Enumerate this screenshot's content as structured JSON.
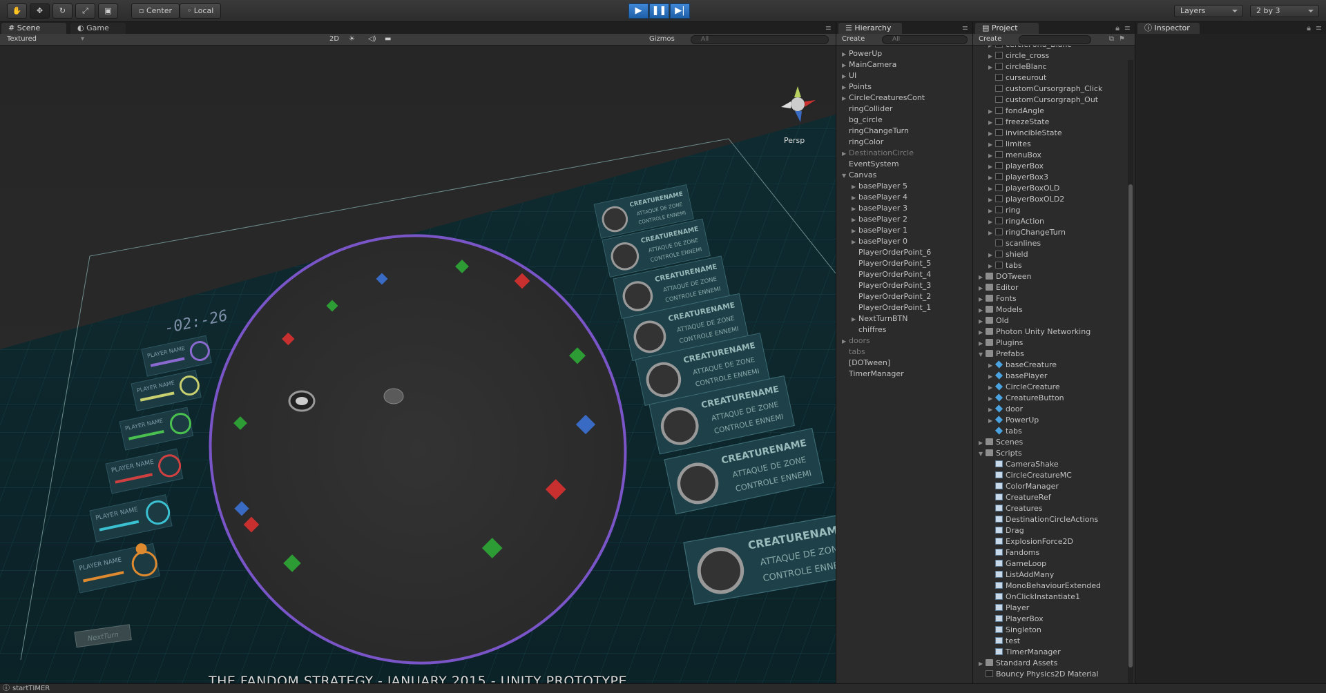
{
  "toolbar": {
    "center_label": "Center",
    "local_label": "Local",
    "layers_label": "Layers",
    "layout_label": "2 by 3"
  },
  "scene_panel": {
    "tabs": [
      {
        "label": "Scene"
      },
      {
        "label": "Game"
      }
    ],
    "render_mode": "Textured",
    "mode_2d": "2D",
    "gizmos": "Gizmos",
    "search_placeholder": "All",
    "persp": "Persp",
    "timer": "-02:-26",
    "player_name": "PLAYER NAME",
    "next_turn": "NextTurn",
    "creature_name": "CREATURENAME",
    "attack_zone": "ATTAQUE DE ZONE",
    "control_enemy": "CONTROLE ENNEMI"
  },
  "hierarchy": {
    "title": "Hierarchy",
    "create": "Create",
    "search": "All",
    "items": [
      {
        "label": "PowerUp",
        "indent": 0,
        "arrow": true,
        "dim": false
      },
      {
        "label": "MainCamera",
        "indent": 0,
        "arrow": true,
        "dim": false
      },
      {
        "label": "UI",
        "indent": 0,
        "arrow": true,
        "dim": false
      },
      {
        "label": "Points",
        "indent": 0,
        "arrow": true,
        "dim": false
      },
      {
        "label": "CircleCreaturesCont",
        "indent": 0,
        "arrow": true,
        "dim": false
      },
      {
        "label": "ringCollider",
        "indent": 0,
        "arrow": false,
        "dim": false
      },
      {
        "label": "bg_circle",
        "indent": 0,
        "arrow": false,
        "dim": false
      },
      {
        "label": "ringChangeTurn",
        "indent": 0,
        "arrow": false,
        "dim": false
      },
      {
        "label": "ringColor",
        "indent": 0,
        "arrow": false,
        "dim": false
      },
      {
        "label": "DestinationCircle",
        "indent": 0,
        "arrow": true,
        "dim": true
      },
      {
        "label": "EventSystem",
        "indent": 0,
        "arrow": false,
        "dim": false
      },
      {
        "label": "Canvas",
        "indent": 0,
        "arrow": true,
        "open": true,
        "dim": false
      },
      {
        "label": "basePlayer 5",
        "indent": 1,
        "arrow": true,
        "dim": false
      },
      {
        "label": "basePlayer 4",
        "indent": 1,
        "arrow": true,
        "dim": false
      },
      {
        "label": "basePlayer 3",
        "indent": 1,
        "arrow": true,
        "dim": false
      },
      {
        "label": "basePlayer 2",
        "indent": 1,
        "arrow": true,
        "dim": false
      },
      {
        "label": "basePlayer 1",
        "indent": 1,
        "arrow": true,
        "dim": false
      },
      {
        "label": "basePlayer 0",
        "indent": 1,
        "arrow": true,
        "dim": false
      },
      {
        "label": "PlayerOrderPoint_6",
        "indent": 1,
        "arrow": false,
        "dim": false
      },
      {
        "label": "PlayerOrderPoint_5",
        "indent": 1,
        "arrow": false,
        "dim": false
      },
      {
        "label": "PlayerOrderPoint_4",
        "indent": 1,
        "arrow": false,
        "dim": false
      },
      {
        "label": "PlayerOrderPoint_3",
        "indent": 1,
        "arrow": false,
        "dim": false
      },
      {
        "label": "PlayerOrderPoint_2",
        "indent": 1,
        "arrow": false,
        "dim": false
      },
      {
        "label": "PlayerOrderPoint_1",
        "indent": 1,
        "arrow": false,
        "dim": false
      },
      {
        "label": "NextTurnBTN",
        "indent": 1,
        "arrow": true,
        "dim": false
      },
      {
        "label": "chiffres",
        "indent": 1,
        "arrow": false,
        "dim": false
      },
      {
        "label": "doors",
        "indent": 0,
        "arrow": true,
        "dim": true
      },
      {
        "label": "tabs",
        "indent": 0,
        "arrow": false,
        "dim": true
      },
      {
        "label": "[DOTween]",
        "indent": 0,
        "arrow": false,
        "dim": false
      },
      {
        "label": "TimerManager",
        "indent": 0,
        "arrow": false,
        "dim": false
      }
    ]
  },
  "project": {
    "title": "Project",
    "create": "Create",
    "items": [
      {
        "label": "cercleFond_Blanc",
        "indent": 1,
        "icon": "sprite",
        "arrow": true
      },
      {
        "label": "circle_cross",
        "indent": 1,
        "icon": "sprite",
        "arrow": true
      },
      {
        "label": "circleBlanc",
        "indent": 1,
        "icon": "sprite",
        "arrow": true
      },
      {
        "label": "curseurout",
        "indent": 1,
        "icon": "sprite",
        "arrow": false
      },
      {
        "label": "customCursorgraph_Click",
        "indent": 1,
        "icon": "sprite",
        "arrow": false
      },
      {
        "label": "customCursorgraph_Out",
        "indent": 1,
        "icon": "sprite",
        "arrow": false
      },
      {
        "label": "fondAngle",
        "indent": 1,
        "icon": "sprite",
        "arrow": true
      },
      {
        "label": "freezeState",
        "indent": 1,
        "icon": "sprite",
        "arrow": true
      },
      {
        "label": "invincibleState",
        "indent": 1,
        "icon": "sprite",
        "arrow": true
      },
      {
        "label": "limites",
        "indent": 1,
        "icon": "sprite",
        "arrow": true
      },
      {
        "label": "menuBox",
        "indent": 1,
        "icon": "sprite",
        "arrow": true
      },
      {
        "label": "playerBox",
        "indent": 1,
        "icon": "sprite",
        "arrow": true
      },
      {
        "label": "playerBox3",
        "indent": 1,
        "icon": "sprite",
        "arrow": true
      },
      {
        "label": "playerBoxOLD",
        "indent": 1,
        "icon": "sprite",
        "arrow": true
      },
      {
        "label": "playerBoxOLD2",
        "indent": 1,
        "icon": "sprite",
        "arrow": true
      },
      {
        "label": "ring",
        "indent": 1,
        "icon": "sprite",
        "arrow": true
      },
      {
        "label": "ringAction",
        "indent": 1,
        "icon": "sprite",
        "arrow": true
      },
      {
        "label": "ringChangeTurn",
        "indent": 1,
        "icon": "sprite",
        "arrow": true
      },
      {
        "label": "scanlines",
        "indent": 1,
        "icon": "sprite",
        "arrow": false
      },
      {
        "label": "shield",
        "indent": 1,
        "icon": "sprite",
        "arrow": true
      },
      {
        "label": "tabs",
        "indent": 1,
        "icon": "sprite",
        "arrow": true
      },
      {
        "label": "DOTween",
        "indent": 0,
        "icon": "folder",
        "arrow": true
      },
      {
        "label": "Editor",
        "indent": 0,
        "icon": "folder",
        "arrow": true
      },
      {
        "label": "Fonts",
        "indent": 0,
        "icon": "folder",
        "arrow": true
      },
      {
        "label": "Models",
        "indent": 0,
        "icon": "folder",
        "arrow": true
      },
      {
        "label": "Old",
        "indent": 0,
        "icon": "folder",
        "arrow": true
      },
      {
        "label": "Photon Unity Networking",
        "indent": 0,
        "icon": "folder",
        "arrow": true
      },
      {
        "label": "Plugins",
        "indent": 0,
        "icon": "folder",
        "arrow": true
      },
      {
        "label": "Prefabs",
        "indent": 0,
        "icon": "folder",
        "arrow": true,
        "open": true
      },
      {
        "label": "baseCreature",
        "indent": 1,
        "icon": "prefab",
        "arrow": true
      },
      {
        "label": "basePlayer",
        "indent": 1,
        "icon": "prefab",
        "arrow": true
      },
      {
        "label": "CircleCreature",
        "indent": 1,
        "icon": "prefab",
        "arrow": true
      },
      {
        "label": "CreatureButton",
        "indent": 1,
        "icon": "prefab",
        "arrow": true
      },
      {
        "label": "door",
        "indent": 1,
        "icon": "prefab",
        "arrow": true
      },
      {
        "label": "PowerUp",
        "indent": 1,
        "icon": "prefab",
        "arrow": true
      },
      {
        "label": "tabs",
        "indent": 1,
        "icon": "prefab",
        "arrow": false
      },
      {
        "label": "Scenes",
        "indent": 0,
        "icon": "folder",
        "arrow": true
      },
      {
        "label": "Scripts",
        "indent": 0,
        "icon": "folder",
        "arrow": true,
        "open": true
      },
      {
        "label": "CameraShake",
        "indent": 1,
        "icon": "script",
        "arrow": false
      },
      {
        "label": "CircleCreatureMC",
        "indent": 1,
        "icon": "script",
        "arrow": false
      },
      {
        "label": "ColorManager",
        "indent": 1,
        "icon": "script",
        "arrow": false
      },
      {
        "label": "CreatureRef",
        "indent": 1,
        "icon": "script",
        "arrow": false
      },
      {
        "label": "Creatures",
        "indent": 1,
        "icon": "script",
        "arrow": false
      },
      {
        "label": "DestinationCircleActions",
        "indent": 1,
        "icon": "script",
        "arrow": false
      },
      {
        "label": "Drag",
        "indent": 1,
        "icon": "script",
        "arrow": false
      },
      {
        "label": "ExplosionForce2D",
        "indent": 1,
        "icon": "script",
        "arrow": false
      },
      {
        "label": "Fandoms",
        "indent": 1,
        "icon": "script",
        "arrow": false
      },
      {
        "label": "GameLoop",
        "indent": 1,
        "icon": "script",
        "arrow": false
      },
      {
        "label": "ListAddMany",
        "indent": 1,
        "icon": "script",
        "arrow": false
      },
      {
        "label": "MonoBehaviourExtended",
        "indent": 1,
        "icon": "script",
        "arrow": false
      },
      {
        "label": "OnClickInstantiate1",
        "indent": 1,
        "icon": "script",
        "arrow": false
      },
      {
        "label": "Player",
        "indent": 1,
        "icon": "script",
        "arrow": false
      },
      {
        "label": "PlayerBox",
        "indent": 1,
        "icon": "script",
        "arrow": false
      },
      {
        "label": "Singleton",
        "indent": 1,
        "icon": "script",
        "arrow": false
      },
      {
        "label": "test",
        "indent": 1,
        "icon": "script",
        "arrow": false
      },
      {
        "label": "TimerManager",
        "indent": 1,
        "icon": "script",
        "arrow": false
      },
      {
        "label": "Standard Assets",
        "indent": 0,
        "icon": "folder",
        "arrow": true
      },
      {
        "label": "Bouncy Physics2D Material",
        "indent": 0,
        "icon": "sprite",
        "arrow": false
      }
    ]
  },
  "inspector": {
    "title": "Inspector"
  },
  "status": {
    "text": "startTIMER"
  },
  "caption": "THE FANDOM STRATEGY - JANUARY 2015 - UNITY PROTOTYPE",
  "colors": {
    "accent": "#2f73c2",
    "ring": "#7a55c8",
    "grid": "#1a4a52"
  }
}
